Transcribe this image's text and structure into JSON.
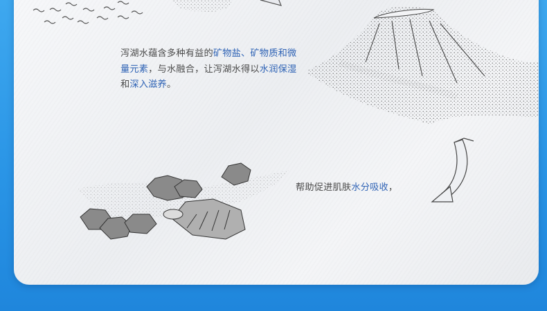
{
  "paragraph1": {
    "t1": "泻湖水蕴含多种有益的",
    "t2": "矿物盐、矿物质和微量元素",
    "t3": "，与水融合，让泻湖水得以",
    "t4": "水润保湿",
    "t5": "和",
    "t6": "深入滋养",
    "t7": "。"
  },
  "paragraph2": {
    "t1": "帮助促进肌肤",
    "t2": "水分吸收",
    "t3": "，"
  },
  "colors": {
    "background_blue": "#2a95e6",
    "highlight_text": "#2f63b5",
    "body_text": "#4a4a4a",
    "card": "#f1f2f4"
  },
  "icons": [
    "volcano-sketch",
    "rocks-and-water-sketch",
    "curved-arrow-down-left",
    "arrow-fragment-top"
  ]
}
